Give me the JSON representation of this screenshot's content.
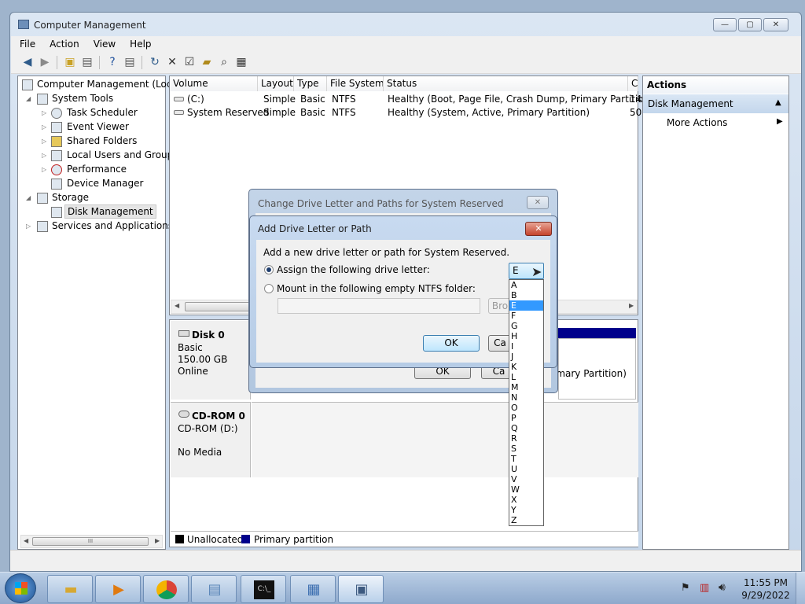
{
  "window": {
    "title": "Computer Management",
    "menu": [
      "File",
      "Action",
      "View",
      "Help"
    ]
  },
  "tree": {
    "root": "Computer Management (Local",
    "system_tools": "System Tools",
    "task_scheduler": "Task Scheduler",
    "event_viewer": "Event Viewer",
    "shared_folders": "Shared Folders",
    "local_users": "Local Users and Groups",
    "performance": "Performance",
    "device_manager": "Device Manager",
    "storage": "Storage",
    "disk_management": "Disk Management",
    "services": "Services and Applications"
  },
  "volumes": {
    "headers": [
      "Volume",
      "Layout",
      "Type",
      "File System",
      "Status",
      "C"
    ],
    "rows": [
      {
        "volume": "(C:)",
        "layout": "Simple",
        "type": "Basic",
        "fs": "NTFS",
        "status": "Healthy (Boot, Page File, Crash Dump, Primary Partition)",
        "c": "14"
      },
      {
        "volume": "System Reserved",
        "layout": "Simple",
        "type": "Basic",
        "fs": "NTFS",
        "status": "Healthy (System, Active, Primary Partition)",
        "c": "50"
      }
    ]
  },
  "disks": {
    "disk0": {
      "name": "Disk 0",
      "type": "Basic",
      "size": "150.00 GB",
      "state": "Online"
    },
    "cdrom0": {
      "name": "CD-ROM 0",
      "type": "CD-ROM (D:)",
      "state": "No Media"
    },
    "partition_text": "imary Partition)"
  },
  "legend": {
    "unallocated": "Unallocated",
    "primary": "Primary partition",
    "unallocated_color": "#000000",
    "primary_color": "#00008b"
  },
  "actions": {
    "title": "Actions",
    "section": "Disk Management",
    "more": "More Actions"
  },
  "outer_dialog": {
    "title": "Change Drive Letter and Paths for System Reserved",
    "ok": "OK",
    "cancel": "Ca"
  },
  "dialog": {
    "title": "Add Drive Letter or Path",
    "intro": "Add a new drive letter or path for System Reserved.",
    "assign": "Assign the following drive letter:",
    "mount": "Mount in the following empty NTFS folder:",
    "browse": "Bro",
    "ok": "OK",
    "cancel": "Ca",
    "selected_letter": "E"
  },
  "letters": [
    "A",
    "B",
    "E",
    "F",
    "G",
    "H",
    "I",
    "J",
    "K",
    "L",
    "M",
    "N",
    "O",
    "P",
    "Q",
    "R",
    "S",
    "T",
    "U",
    "V",
    "W",
    "X",
    "Y",
    "Z"
  ],
  "taskbar": {
    "time": "11:55 PM",
    "date": "9/29/2022"
  }
}
